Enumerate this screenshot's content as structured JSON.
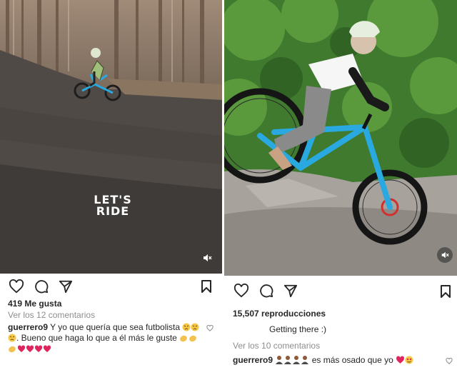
{
  "left_post": {
    "likes": "419 Me gusta",
    "view_comments": "Ver los 12 comentarios",
    "comment_user": "guerrero9",
    "comment_line1": "Y yo que quería que sea futbolista",
    "comment_line2": ". Bueno que haga lo que a él más le guste",
    "overlay_logo_line1": "LET'S",
    "overlay_logo_line2": "RIDE",
    "icons": [
      "heart-icon",
      "comment-icon",
      "share-icon",
      "bookmark-icon",
      "mute-icon"
    ]
  },
  "right_post": {
    "views": "15,507 reproducciones",
    "caption": "Getting there :)",
    "view_comments": "Ver los 10 comentarios",
    "comment_user": "guerrero9",
    "comment_text": "es más osado que yo",
    "icons": [
      "heart-icon",
      "comment-icon",
      "share-icon",
      "bookmark-icon",
      "mute-icon"
    ]
  },
  "colors": {
    "text": "#262626",
    "muted": "#8e8e8e",
    "bike_blue": "#29a9e0",
    "red_heart": "#e0245e"
  }
}
